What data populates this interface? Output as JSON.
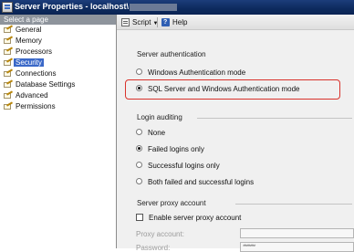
{
  "window": {
    "title": "Server Properties - localhost\\"
  },
  "sidebar": {
    "header": "Select a page",
    "items": [
      {
        "label": "General"
      },
      {
        "label": "Memory"
      },
      {
        "label": "Processors"
      },
      {
        "label": "Security",
        "selected": true
      },
      {
        "label": "Connections"
      },
      {
        "label": "Database Settings"
      },
      {
        "label": "Advanced"
      },
      {
        "label": "Permissions"
      }
    ]
  },
  "toolbar": {
    "script_label": "Script",
    "help_label": "Help"
  },
  "server_auth": {
    "heading": "Server authentication",
    "options": [
      {
        "label": "Windows Authentication mode",
        "checked": false
      },
      {
        "label": "SQL Server and Windows Authentication mode",
        "checked": true
      }
    ]
  },
  "login_auditing": {
    "heading": "Login auditing",
    "options": [
      {
        "label": "None",
        "checked": false
      },
      {
        "label": "Failed logins only",
        "checked": true
      },
      {
        "label": "Successful logins only",
        "checked": false
      },
      {
        "label": "Both failed and successful logins",
        "checked": false
      }
    ]
  },
  "proxy": {
    "heading": "Server proxy account",
    "enable_label": "Enable server proxy account",
    "enable_checked": false,
    "account_label": "Proxy account:",
    "password_label": "Password:",
    "password_value": "**********"
  },
  "colors": {
    "title_bar": "#0d2a5e",
    "selected_item": "#3a68c8",
    "highlight_outline": "#d9322b"
  }
}
